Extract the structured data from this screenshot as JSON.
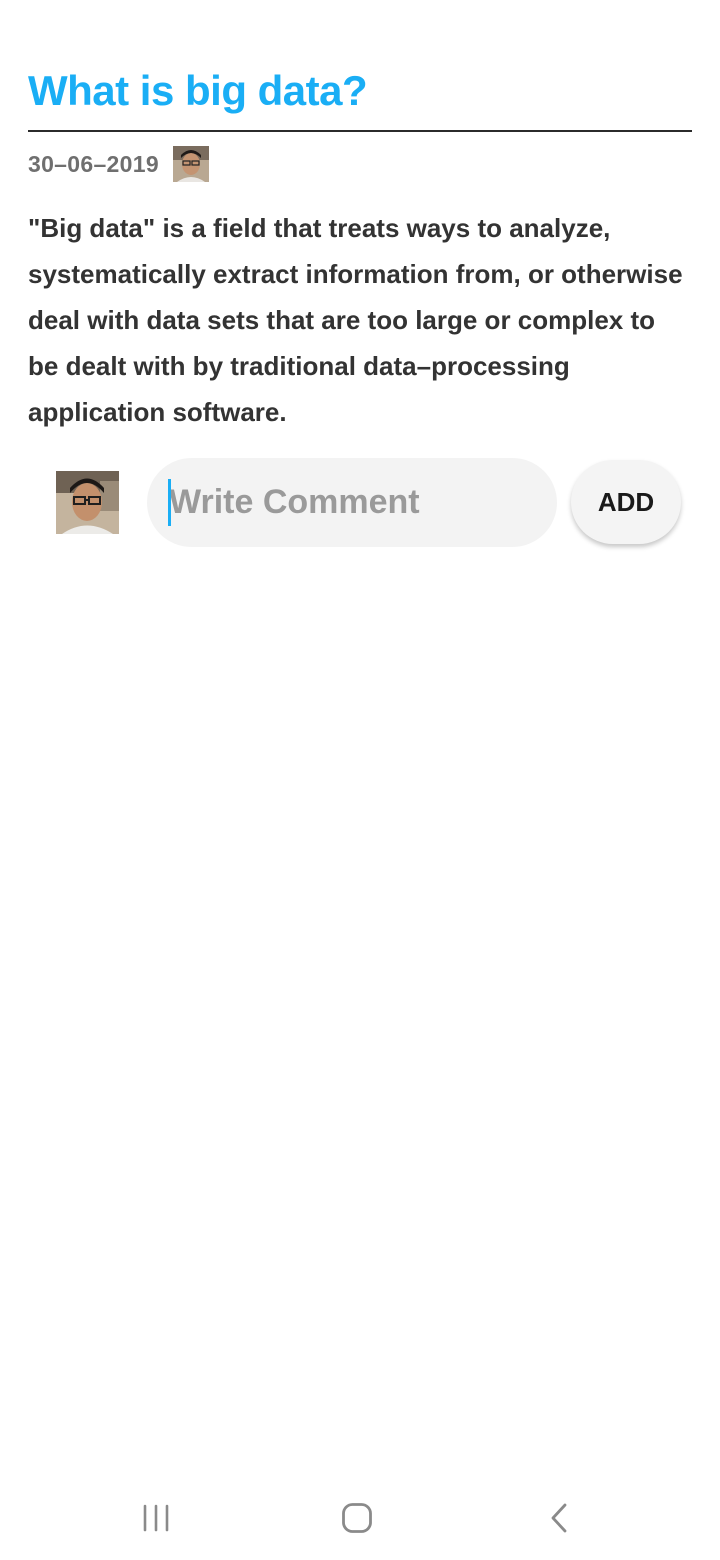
{
  "post": {
    "title": "What is big data?",
    "date": "30–06–2019",
    "body": "\"Big data\" is a field that treats ways to analyze, systematically extract information from, or otherwise deal with data sets that are too large or complex to be dealt with by traditional data–processing application software."
  },
  "comment": {
    "placeholder": "Write Comment",
    "value": "",
    "add_label": "ADD"
  },
  "colors": {
    "accent": "#1aaef5",
    "title_divider": "#2b2b2b",
    "date_text": "#6f6f6f",
    "body_text": "#333333",
    "input_background": "#f3f3f3"
  },
  "icons": {
    "nav_recent": "recent-apps-icon",
    "nav_home": "home-icon",
    "nav_back": "back-icon"
  }
}
